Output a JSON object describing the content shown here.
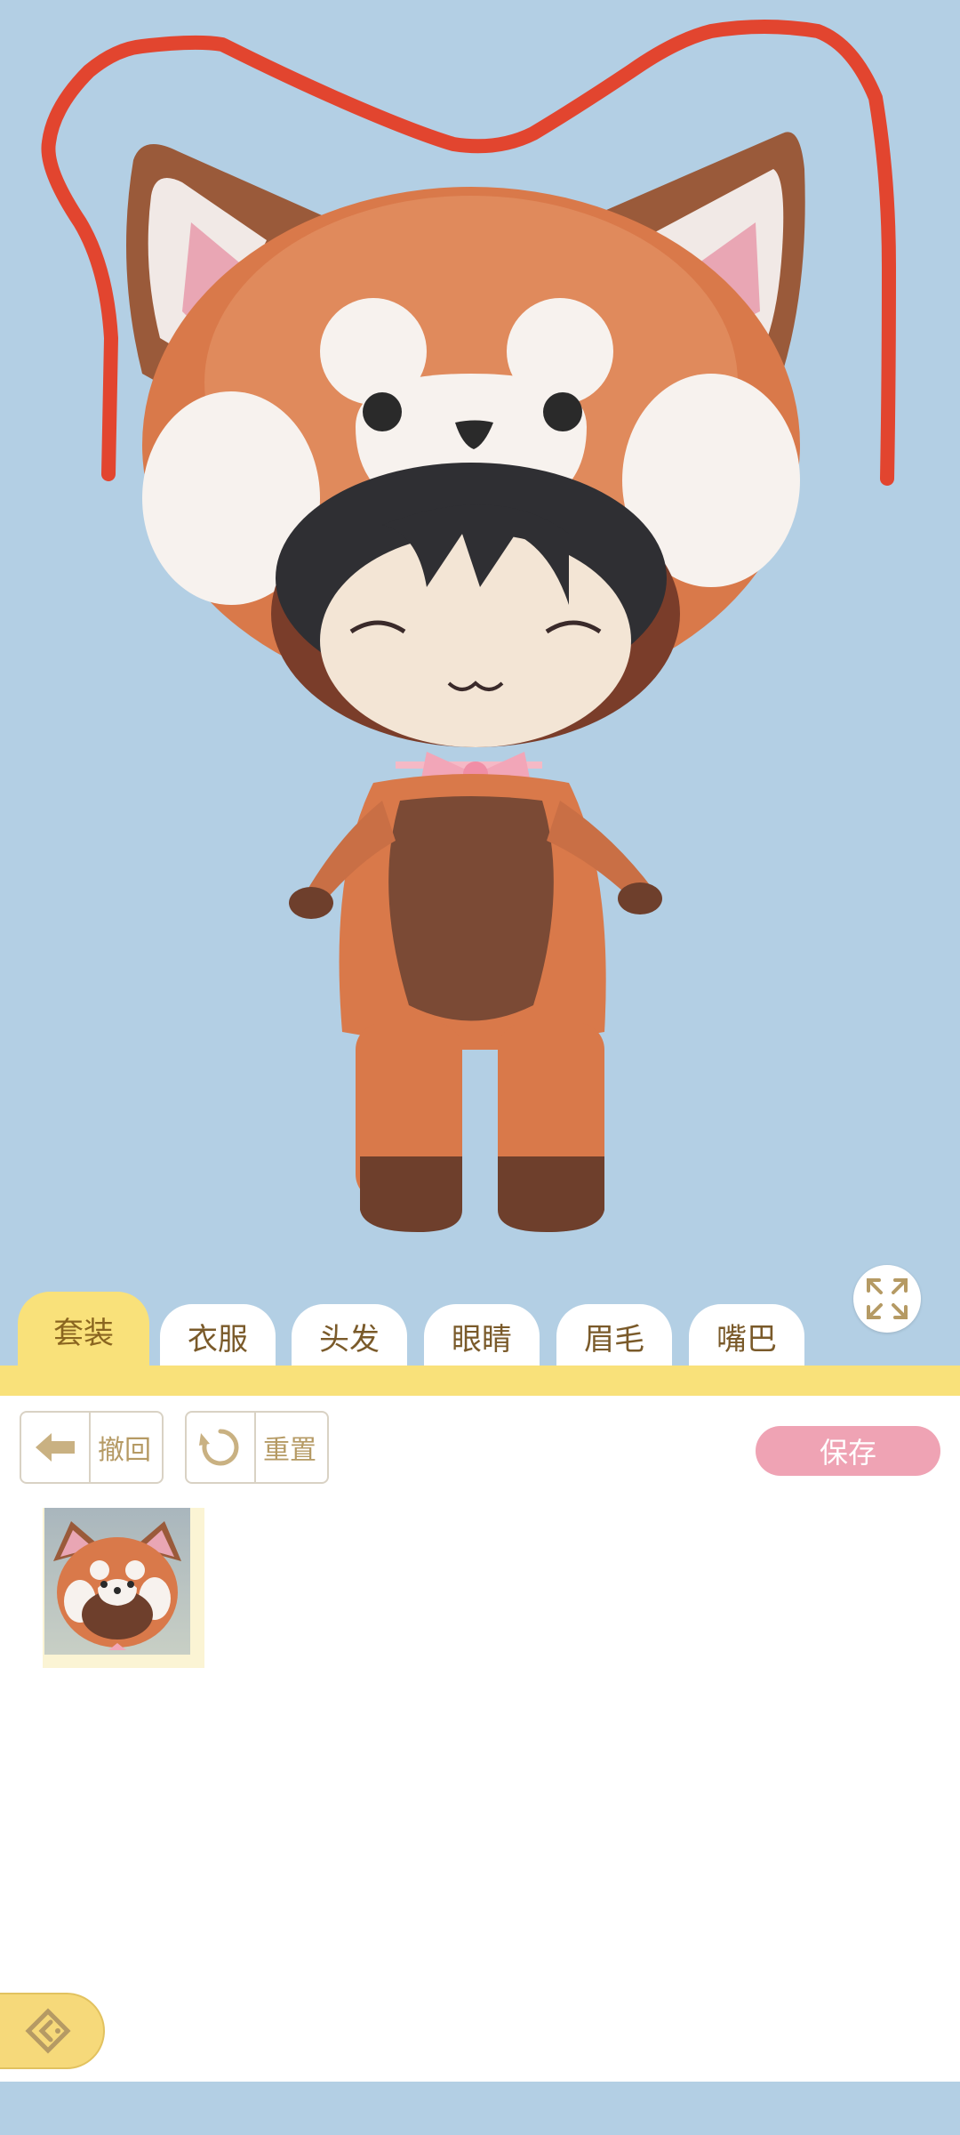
{
  "tabs": [
    {
      "label": "套装",
      "active": true
    },
    {
      "label": "衣服",
      "active": false
    },
    {
      "label": "头发",
      "active": false
    },
    {
      "label": "眼睛",
      "active": false
    },
    {
      "label": "眉毛",
      "active": false
    },
    {
      "label": "嘴巴",
      "active": false
    }
  ],
  "toolbar": {
    "undo_label": "撤回",
    "reset_label": "重置",
    "save_label": "保存"
  },
  "icons": {
    "expand": "expand-icon",
    "undo": "back-arrow-icon",
    "reset": "reset-icon",
    "back": "diamond-back-icon"
  },
  "colors": {
    "stage_bg": "#b3cfe4",
    "accent_yellow": "#f9e17a",
    "save_pink": "#efa3b4",
    "tab_text": "#7a5a2a",
    "annotation_red": "#e2452f"
  }
}
